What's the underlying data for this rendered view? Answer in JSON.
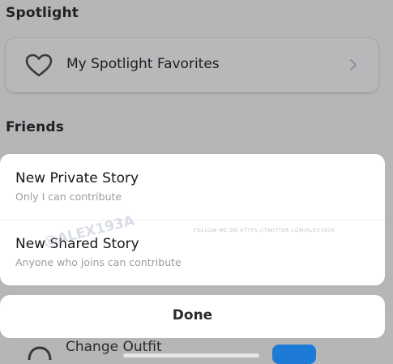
{
  "spotlight": {
    "section_title": "Spotlight",
    "favorites_label": "My Spotlight Favorites"
  },
  "friends": {
    "section_title": "Friends"
  },
  "sheet": {
    "options": [
      {
        "title": "New Private Story",
        "subtitle": "Only I can contribute"
      },
      {
        "title": "New Shared Story",
        "subtitle": "Anyone who joins can contribute"
      }
    ],
    "done_label": "Done"
  },
  "watermark": {
    "follow_text": "FOLLOW ME ON HTTPS://TWITTER.COM/ALEX193A",
    "handle": "@ALEX193A"
  },
  "background_peek": {
    "label": "Change Outfit"
  },
  "colors": {
    "background_dim": "#b5b6b8",
    "sheet": "#ffffff",
    "subtitle": "#9c9ca2",
    "accent": "#1d7bd6"
  },
  "icons": {
    "favorites": "heart-icon",
    "favorites_chevron": "chevron-right-icon",
    "peek": "outfit-icon"
  }
}
